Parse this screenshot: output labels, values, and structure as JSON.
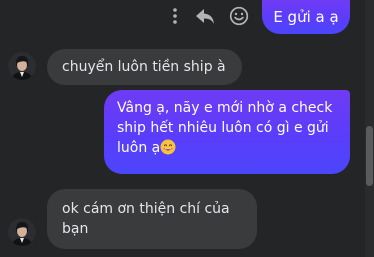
{
  "toolbar": {
    "more_icon": "vertical-ellipsis-icon",
    "forward_icon": "forward-arrow-icon",
    "react_icon": "smiley-icon"
  },
  "messages": [
    {
      "direction": "out",
      "text": "E gửi a ạ"
    },
    {
      "direction": "in",
      "text": "chuyển luôn tiền ship à"
    },
    {
      "direction": "out",
      "lines": [
        "Vâng ạ, nãy e mới nhờ a check",
        "ship hết nhiêu luôn có gì e gửi",
        "luôn ạ"
      ],
      "emoji": "grinning-face-icon"
    },
    {
      "direction": "in",
      "lines": [
        "ok cám ơn thiện chí của",
        "bạn"
      ]
    }
  ],
  "colors": {
    "background": "#242526",
    "incoming_bubble": "#3a3b3c",
    "outgoing_bubble_top": "#6f3bf5",
    "outgoing_bubble_bottom": "#4c46fb"
  }
}
